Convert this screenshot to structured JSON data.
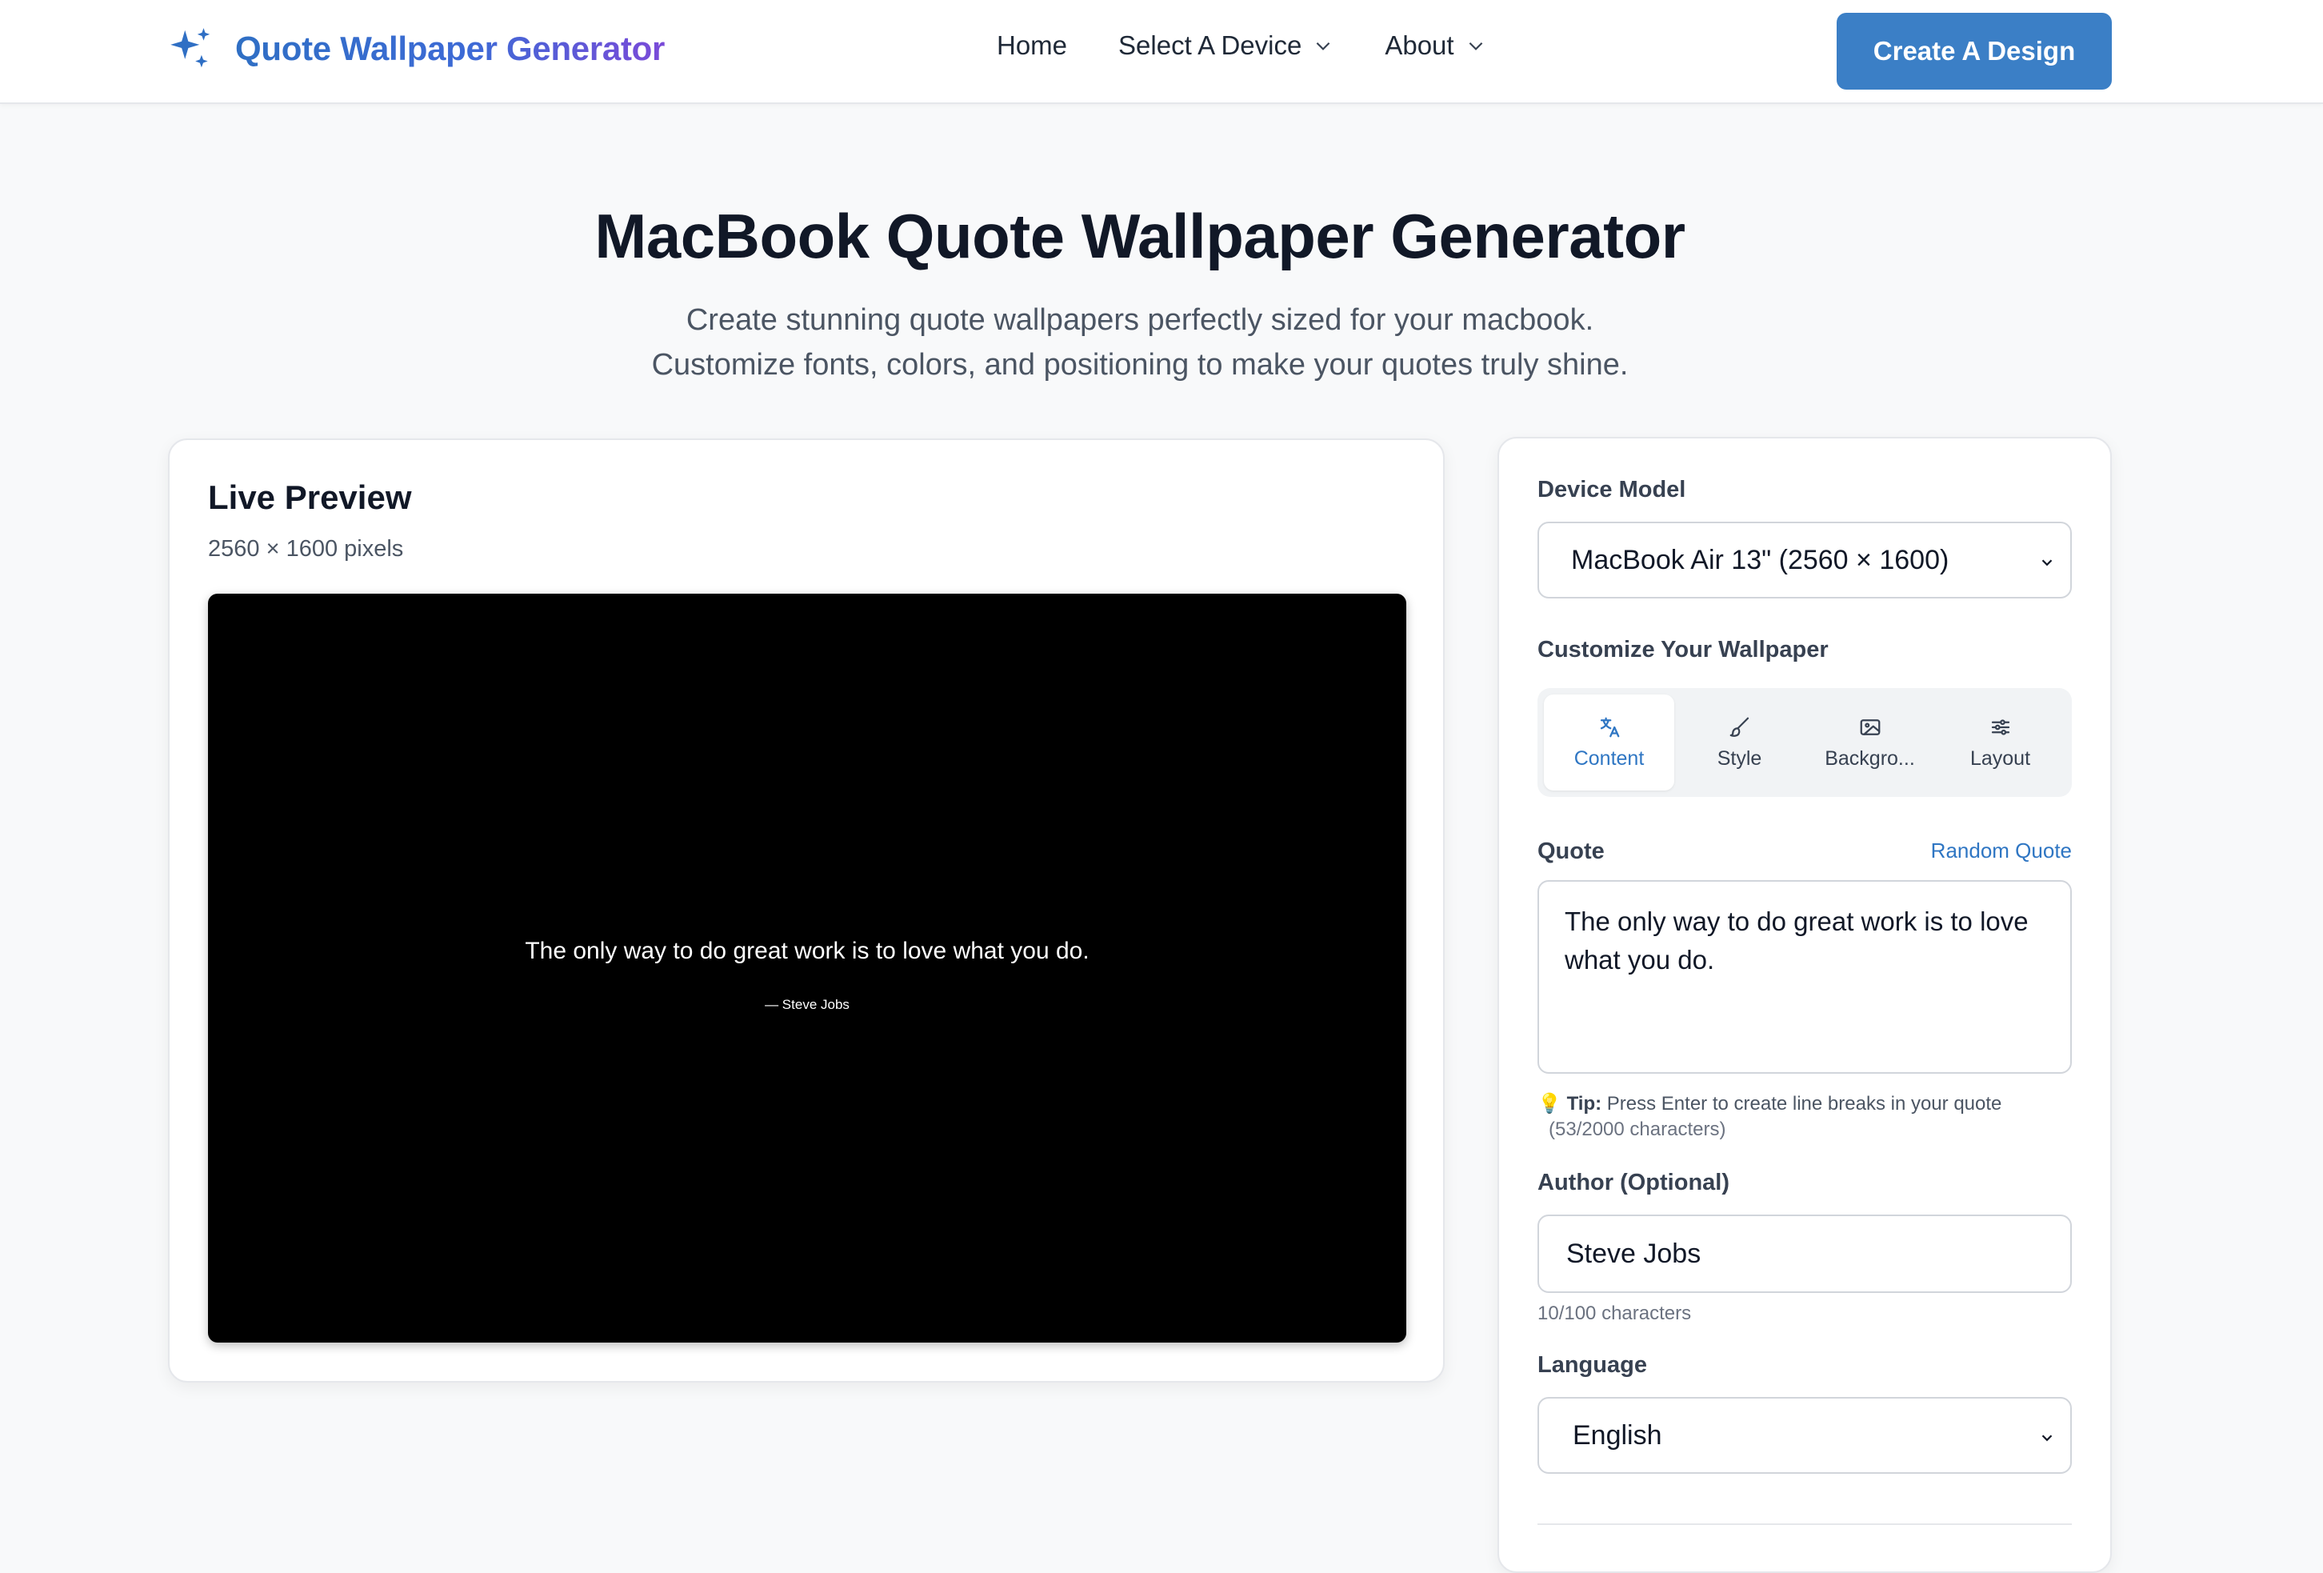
{
  "header": {
    "brand_title": "Quote Wallpaper Generator",
    "brand_icon": "sparkles-icon",
    "nav": {
      "home": "Home",
      "select_device": "Select A Device",
      "about": "About"
    },
    "cta_label": "Create A Design"
  },
  "hero": {
    "title": "MacBook Quote Wallpaper Generator",
    "subtitle_line1": "Create stunning quote wallpapers perfectly sized for your macbook.",
    "subtitle_line2": "Customize fonts, colors, and positioning to make your quotes truly shine."
  },
  "preview": {
    "title": "Live Preview",
    "dimensions": "2560 × 1600 pixels",
    "quote": "The only way to do great work is to love what you do.",
    "author": "— Steve Jobs",
    "background_color": "#000000"
  },
  "controls": {
    "device_model_label": "Device Model",
    "device_model_value": "MacBook Air 13\" (2560 × 1600)",
    "customize_label": "Customize Your Wallpaper",
    "tabs": [
      {
        "label": "Content",
        "icon": "translate-icon",
        "active": true
      },
      {
        "label": "Style",
        "icon": "brush-icon",
        "active": false
      },
      {
        "label": "Backgro...",
        "icon": "image-icon",
        "active": false
      },
      {
        "label": "Layout",
        "icon": "sliders-icon",
        "active": false
      }
    ],
    "quote_label": "Quote",
    "random_quote": "Random Quote",
    "quote_value": "The only way to do great work is to love what you do.",
    "tip_icon": "💡",
    "tip_strong": "Tip:",
    "tip_text": "Press Enter to create line breaks in your quote",
    "tip_count": "(53/2000 characters)",
    "author_label": "Author (Optional)",
    "author_value": "Steve Jobs",
    "author_count": "10/100 characters",
    "language_label": "Language",
    "language_value": "English"
  },
  "colors": {
    "accent": "#3b7fc6",
    "link": "#2f76c3",
    "page_bg": "#f8f9fa"
  }
}
